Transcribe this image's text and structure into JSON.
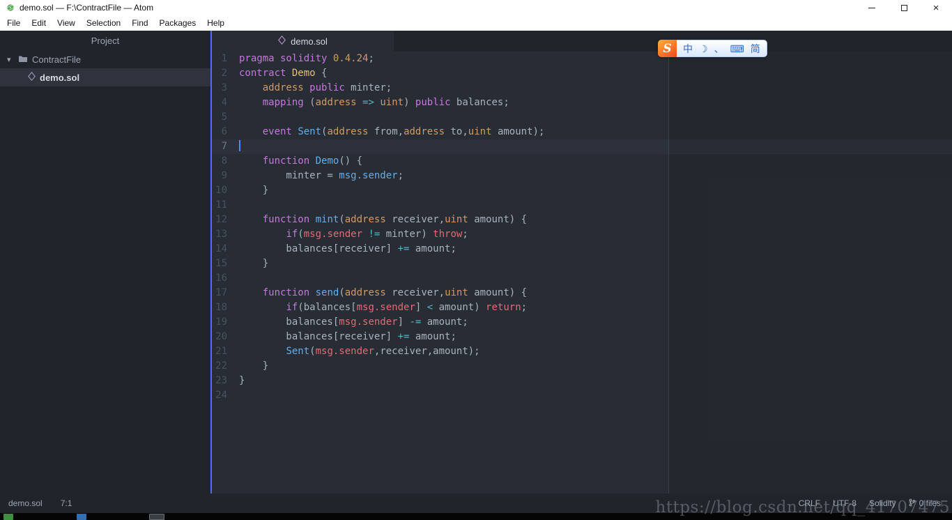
{
  "window": {
    "title": "demo.sol — F:\\ContractFile — Atom",
    "controls": {
      "minimize": "minimize",
      "maximize": "maximize",
      "close": "×"
    }
  },
  "menu": {
    "items": [
      "File",
      "Edit",
      "View",
      "Selection",
      "Find",
      "Packages",
      "Help"
    ]
  },
  "sidebar": {
    "header": "Project",
    "folder": "ContractFile",
    "file": "demo.sol"
  },
  "tabs": [
    {
      "label": "demo.sol"
    }
  ],
  "editor": {
    "active_line": 7,
    "cursor": "7:1",
    "lines": [
      {
        "n": 1,
        "t": [
          [
            "pragma solidity ",
            "k"
          ],
          [
            "0.4.24",
            "n"
          ],
          [
            ";",
            "d"
          ]
        ]
      },
      {
        "n": 2,
        "t": [
          [
            "contract",
            "k"
          ],
          [
            " ",
            "d"
          ],
          [
            "Demo",
            "y"
          ],
          [
            " {",
            "d"
          ]
        ]
      },
      {
        "n": 3,
        "t": [
          [
            "    ",
            "d"
          ],
          [
            "address",
            "t"
          ],
          [
            " ",
            "d"
          ],
          [
            "public",
            "k"
          ],
          [
            " minter;",
            "d"
          ]
        ]
      },
      {
        "n": 4,
        "t": [
          [
            "    ",
            "d"
          ],
          [
            "mapping",
            "k"
          ],
          [
            " (",
            "d"
          ],
          [
            "address",
            "t"
          ],
          [
            " ",
            "d"
          ],
          [
            "=>",
            "o"
          ],
          [
            " ",
            "d"
          ],
          [
            "uint",
            "t"
          ],
          [
            ") ",
            "d"
          ],
          [
            "public",
            "k"
          ],
          [
            " balances;",
            "d"
          ]
        ]
      },
      {
        "n": 5,
        "t": []
      },
      {
        "n": 6,
        "t": [
          [
            "    ",
            "d"
          ],
          [
            "event",
            "k"
          ],
          [
            " ",
            "d"
          ],
          [
            "Sent",
            "f"
          ],
          [
            "(",
            "d"
          ],
          [
            "address",
            "t"
          ],
          [
            " from,",
            "d"
          ],
          [
            "address",
            "t"
          ],
          [
            " to,",
            "d"
          ],
          [
            "uint",
            "t"
          ],
          [
            " amount);",
            "d"
          ]
        ]
      },
      {
        "n": 7,
        "t": []
      },
      {
        "n": 8,
        "t": [
          [
            "    ",
            "d"
          ],
          [
            "function",
            "k"
          ],
          [
            " ",
            "d"
          ],
          [
            "Demo",
            "f"
          ],
          [
            "() {",
            "d"
          ]
        ]
      },
      {
        "n": 9,
        "t": [
          [
            "        minter = ",
            "d"
          ],
          [
            "msg.sender",
            "f"
          ],
          [
            ";",
            "d"
          ]
        ]
      },
      {
        "n": 10,
        "t": [
          [
            "    }",
            "d"
          ]
        ]
      },
      {
        "n": 11,
        "t": []
      },
      {
        "n": 12,
        "t": [
          [
            "    ",
            "d"
          ],
          [
            "function",
            "k"
          ],
          [
            " ",
            "d"
          ],
          [
            "mint",
            "f"
          ],
          [
            "(",
            "d"
          ],
          [
            "address",
            "t"
          ],
          [
            " receiver,",
            "d"
          ],
          [
            "uint",
            "t"
          ],
          [
            " amount) {",
            "d"
          ]
        ]
      },
      {
        "n": 13,
        "t": [
          [
            "        ",
            "d"
          ],
          [
            "if",
            "k"
          ],
          [
            "(",
            "d"
          ],
          [
            "msg.sender",
            "r"
          ],
          [
            " ",
            "d"
          ],
          [
            "!=",
            "o"
          ],
          [
            " minter) ",
            "d"
          ],
          [
            "throw",
            "r"
          ],
          [
            ";",
            "d"
          ]
        ]
      },
      {
        "n": 14,
        "t": [
          [
            "        balances[receiver] ",
            "d"
          ],
          [
            "+=",
            "o"
          ],
          [
            " amount;",
            "d"
          ]
        ]
      },
      {
        "n": 15,
        "t": [
          [
            "    }",
            "d"
          ]
        ]
      },
      {
        "n": 16,
        "t": []
      },
      {
        "n": 17,
        "t": [
          [
            "    ",
            "d"
          ],
          [
            "function",
            "k"
          ],
          [
            " ",
            "d"
          ],
          [
            "send",
            "f"
          ],
          [
            "(",
            "d"
          ],
          [
            "address",
            "t"
          ],
          [
            " receiver,",
            "d"
          ],
          [
            "uint",
            "t"
          ],
          [
            " amount) {",
            "d"
          ]
        ]
      },
      {
        "n": 18,
        "t": [
          [
            "        ",
            "d"
          ],
          [
            "if",
            "k"
          ],
          [
            "(balances[",
            "d"
          ],
          [
            "msg.sender",
            "r"
          ],
          [
            "] ",
            "d"
          ],
          [
            "<",
            "o"
          ],
          [
            " amount) ",
            "d"
          ],
          [
            "return",
            "r"
          ],
          [
            ";",
            "d"
          ]
        ]
      },
      {
        "n": 19,
        "t": [
          [
            "        balances[",
            "d"
          ],
          [
            "msg.sender",
            "r"
          ],
          [
            "] ",
            "d"
          ],
          [
            "-=",
            "o"
          ],
          [
            " amount;",
            "d"
          ]
        ]
      },
      {
        "n": 20,
        "t": [
          [
            "        balances[receiver] ",
            "d"
          ],
          [
            "+=",
            "o"
          ],
          [
            " amount;",
            "d"
          ]
        ]
      },
      {
        "n": 21,
        "t": [
          [
            "        ",
            "d"
          ],
          [
            "Sent",
            "f"
          ],
          [
            "(",
            "d"
          ],
          [
            "msg.sender",
            "r"
          ],
          [
            ",receiver,amount);",
            "d"
          ]
        ]
      },
      {
        "n": 22,
        "t": [
          [
            "    }",
            "d"
          ]
        ]
      },
      {
        "n": 23,
        "t": [
          [
            "}",
            "d"
          ]
        ]
      },
      {
        "n": 24,
        "t": []
      }
    ]
  },
  "ime": {
    "logo": "S",
    "mode_cn": "中",
    "moon": "☽",
    "punct": "、",
    "keyboard": "⌨",
    "simplified": "简"
  },
  "status": {
    "file": "demo.sol",
    "cursor": "7:1",
    "line_ending": "CRLF",
    "encoding": "UTF-8",
    "grammar": "Solidity",
    "git": "0 files"
  },
  "watermark": "https://blog.csdn.net/qq_41707475",
  "colors": {
    "accent": "#528bff",
    "keyword": "#c678dd",
    "type": "#d19a66",
    "func": "#61afef",
    "classname": "#e5c07b",
    "variable": "#e06c75",
    "operator": "#56b6c2",
    "number": "#d19a66",
    "text": "#abb2bf",
    "bg": "#282c34",
    "panel": "#21252b",
    "highlight": "#2c313c",
    "divider": "#4972f4"
  }
}
